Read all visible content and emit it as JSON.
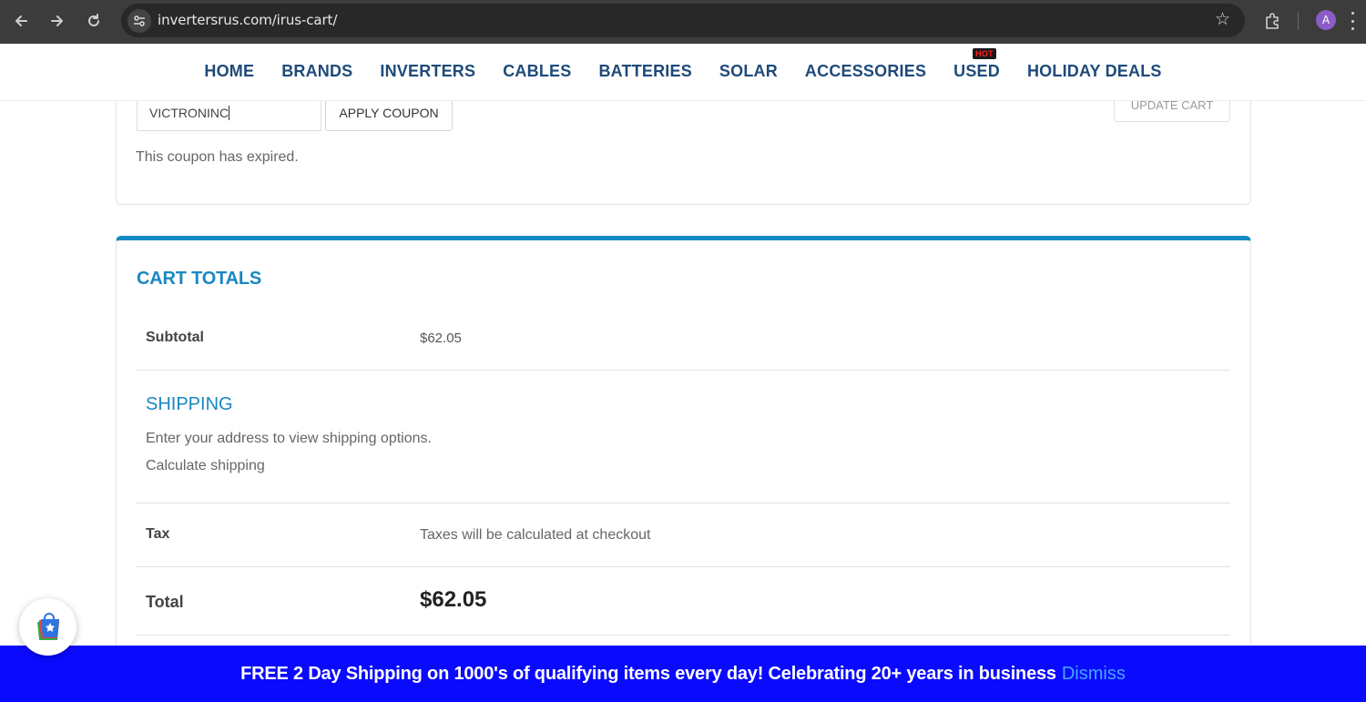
{
  "browser": {
    "url": "invertersrus.com/irus-cart/",
    "profile_initial": "A",
    "icons": [
      "back-icon",
      "forward-icon",
      "reload-icon",
      "site-info-icon",
      "bookmark-star-icon",
      "extensions-icon",
      "menu-icon"
    ]
  },
  "site_nav": {
    "items": [
      "HOME",
      "BRANDS",
      "INVERTERS",
      "CABLES",
      "BATTERIES",
      "SOLAR",
      "ACCESSORIES",
      "USED",
      "HOLIDAY DEALS"
    ],
    "hot_badge": "HOT"
  },
  "coupon": {
    "value": "VICTRONINC",
    "apply_label": "APPLY COUPON",
    "update_label": "UPDATE CART",
    "message": "This coupon has expired."
  },
  "cart_totals": {
    "title": "CART TOTALS",
    "subtotal_label": "Subtotal",
    "subtotal_value": "$62.05",
    "shipping_title": "SHIPPING",
    "shipping_note": "Enter your address to view shipping options.",
    "shipping_link": "Calculate shipping",
    "tax_label": "Tax",
    "tax_value": "Taxes will be calculated at checkout",
    "total_label": "Total",
    "total_value": "$62.05"
  },
  "promo": {
    "text": "FREE 2 Day Shipping on 1000's of qualifying items every day! Celebrating 20+ years in business",
    "dismiss": "Dismiss"
  },
  "colors": {
    "accent": "#1a87c2",
    "nav_text": "#1e4a7a",
    "promo_bg": "#0a0aff",
    "dismiss": "#46a8ff"
  }
}
